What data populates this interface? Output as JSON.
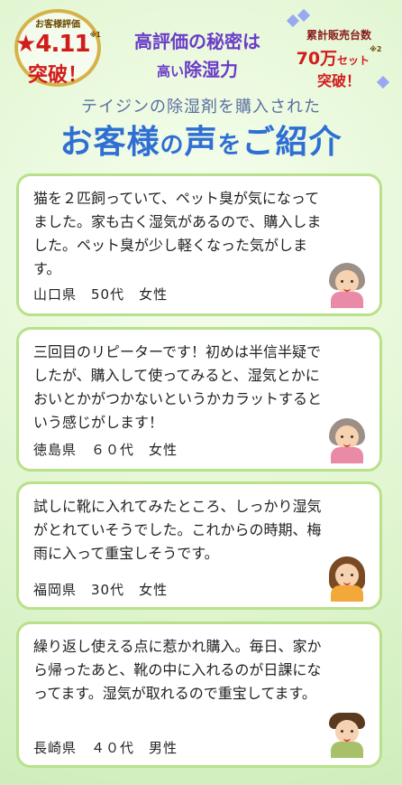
{
  "header": {
    "rating_badge": {
      "caption": "お客様評価",
      "score": "★4.11",
      "note": "※1",
      "suffix": "突破！"
    },
    "catch_line1": "高評価の秘密は",
    "catch_line2_small": "高い",
    "catch_line2_main": "除湿力",
    "sales_badge": {
      "caption": "累計販売台数",
      "number": "70万",
      "unit": "セット",
      "note": "※2",
      "suffix": "突破！"
    },
    "lead": "テイジンの除湿剤を購入された",
    "title_a": "お客様",
    "title_b": "の",
    "title_c": "声",
    "title_d": "を",
    "title_e": "ご紹介"
  },
  "reviews": [
    {
      "text": "猫を２匹飼っていて、ペット臭が気になってました。家も古く湿気があるので、購入しました。ペット臭が少し軽くなった気がします。",
      "author": "山口県　50代　女性",
      "avatar": "elderly-woman-icon"
    },
    {
      "text": "三回目のリピーターです！初めは半信半疑でしたが、購入して使ってみると、湿気とかにおいとかがつかないというかカラットするという感じがします！",
      "author": "徳島県　６０代　女性",
      "avatar": "elderly-woman-icon"
    },
    {
      "text": "試しに靴に入れてみたところ、しっかり湿気がとれていそうでした。これからの時期、梅雨に入って重宝しそうです。",
      "author": "福岡県　30代　女性",
      "avatar": "woman-icon"
    },
    {
      "text": "繰り返し使える点に惹かれ購入。毎日、家から帰ったあと、靴の中に入れるのが日課になってます。湿気が取れるので重宝してます。",
      "author": "長崎県　４０代　男性",
      "avatar": "man-icon"
    }
  ],
  "colors": {
    "accent_purple": "#6a3cc8",
    "accent_blue": "#2f6fd4",
    "accent_red": "#d21b1b",
    "card_border": "#b9e08a"
  }
}
